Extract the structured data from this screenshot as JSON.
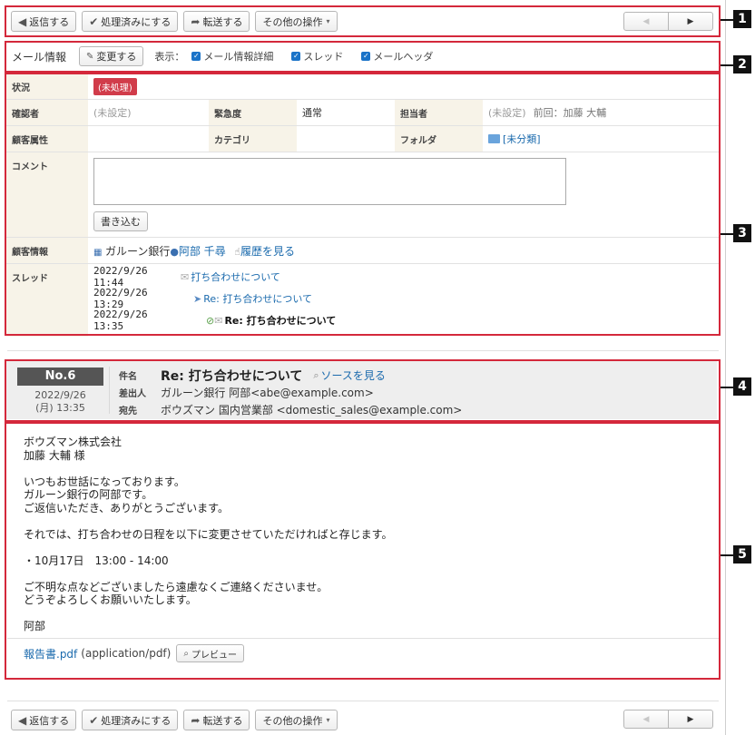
{
  "toolbar": {
    "reply": "返信する",
    "mark_done": "処理済みにする",
    "forward": "転送する",
    "other": "その他の操作",
    "other_caret": "▾",
    "prev": "◀",
    "next": "▶"
  },
  "info_bar": {
    "title": "メール情報",
    "change_btn": "変更する",
    "display_label": "表示：",
    "options": [
      "メール情報詳細",
      "スレッド",
      "メールヘッダ"
    ]
  },
  "props": {
    "status_label": "状況",
    "status_value": "(未処理)",
    "confirmer_label": "確認者",
    "confirmer_value": "(未設定)",
    "urgency_label": "緊急度",
    "urgency_value": "通常",
    "owner_label": "担当者",
    "owner_value": "(未設定)",
    "owner_prev": "前回：加藤 大輔",
    "customer_attr_label": "顧客属性",
    "category_label": "カテゴリ",
    "folder_label": "フォルダ",
    "folder_value": "[未分類]",
    "comment_label": "コメント",
    "write_btn": "書き込む",
    "customer_info_label": "顧客情報",
    "customer_company": "ガルーン銀行",
    "customer_person": "阿部 千尋",
    "history_link": "履歴を見る",
    "thread_label": "スレッド",
    "threads": [
      {
        "date": "2022/9/26 11:44",
        "subject": "打ち合わせについて"
      },
      {
        "date": "2022/9/26 13:29",
        "subject": "Re: 打ち合わせについて"
      },
      {
        "date": "2022/9/26 13:35",
        "subject": "Re: 打ち合わせについて"
      }
    ]
  },
  "mail": {
    "no": "No.6",
    "date": "2022/9/26",
    "time": "(月) 13:35",
    "subject_label": "件名",
    "subject": "Re: 打ち合わせについて",
    "source_link": "ソースを見る",
    "from_label": "差出人",
    "from": "ガルーン銀行 阿部<abe@example.com>",
    "to_label": "宛先",
    "to": "ボウズマン 国内営業部 <domestic_sales@example.com>",
    "body": "ボウズマン株式会社\n加藤 大輔 様\n\nいつもお世話になっております。\nガルーン銀行の阿部です。\nご返信いただき、ありがとうございます。\n\nそれでは、打ち合わせの日程を以下に変更させていただければと存じます。\n\n・10月17日　13:00 - 14:00\n\nご不明な点などございましたら遠慮なくご連絡くださいませ。\nどうぞよろしくお願いいたします。\n\n阿部",
    "attachment_name": "報告書.pdf",
    "attachment_type": "(application/pdf)",
    "preview_btn": "プレビュー"
  },
  "markers": [
    "1",
    "2",
    "3",
    "4",
    "5"
  ],
  "colors": {
    "highlight": "#d4283b",
    "link": "#1a6aad",
    "badge": "#d13c4a"
  }
}
